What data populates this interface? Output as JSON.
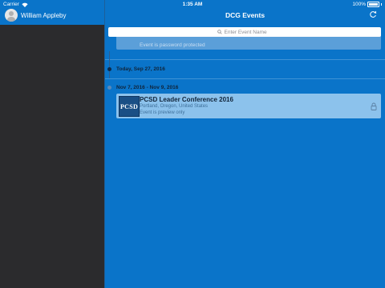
{
  "status_bar": {
    "carrier": "Carrier",
    "time": "1:35 AM",
    "battery": "100%"
  },
  "sidebar": {
    "user_name": "William Appleby"
  },
  "header": {
    "title": "DCG Events"
  },
  "search": {
    "placeholder": "Enter Event Name"
  },
  "previous_event": {
    "note": "Event is password protected"
  },
  "sections": [
    {
      "date_label": "Today, Sep 27, 2016"
    },
    {
      "date_label": "Nov 7, 2016 - Nov 9, 2016"
    }
  ],
  "event": {
    "logo_text": "PCSD",
    "title": "PCSD Leader Conference 2016",
    "location": "Portland, Oregon, United States",
    "note": "Event is preview only"
  },
  "colors": {
    "primary": "#0a74c9",
    "sidebar_bg": "#2b2b2d",
    "card_bg": "#8cc2ec"
  },
  "icons": [
    "wifi-icon",
    "battery-icon",
    "avatar-icon",
    "refresh-icon",
    "search-icon",
    "lock-icon"
  ]
}
